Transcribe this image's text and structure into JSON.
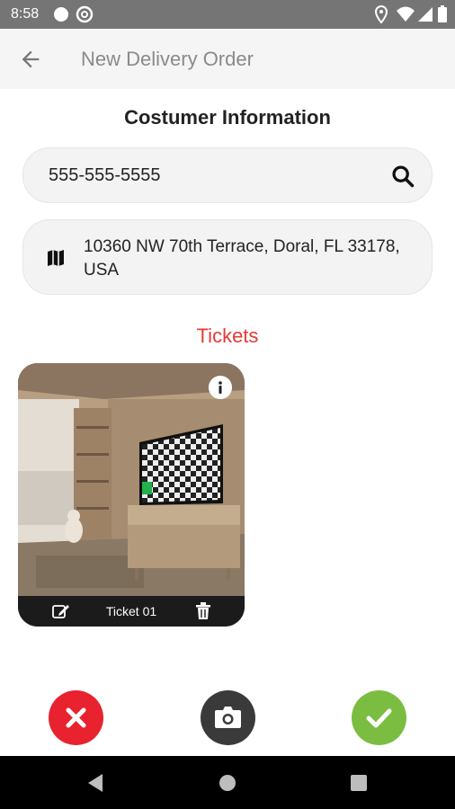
{
  "status_bar": {
    "time": "8:58"
  },
  "app_bar": {
    "title": "New Delivery Order"
  },
  "customer": {
    "section_title": "Costumer Information",
    "phone": "555-555-5555",
    "address": "10360 NW 70th Terrace, Doral, FL 33178, USA"
  },
  "tickets": {
    "section_title": "Tickets",
    "items": [
      {
        "label": "Ticket 01"
      }
    ]
  },
  "colors": {
    "accent_red": "#e53935",
    "cancel": "#e8222e",
    "camera": "#3a3a3a",
    "confirm": "#7bbd40",
    "status_bar": "#757575"
  },
  "icons": [
    "arrow-back-icon",
    "search-icon",
    "map-icon",
    "info-icon",
    "edit-icon",
    "trash-icon",
    "close-icon",
    "camera-icon",
    "check-icon"
  ]
}
